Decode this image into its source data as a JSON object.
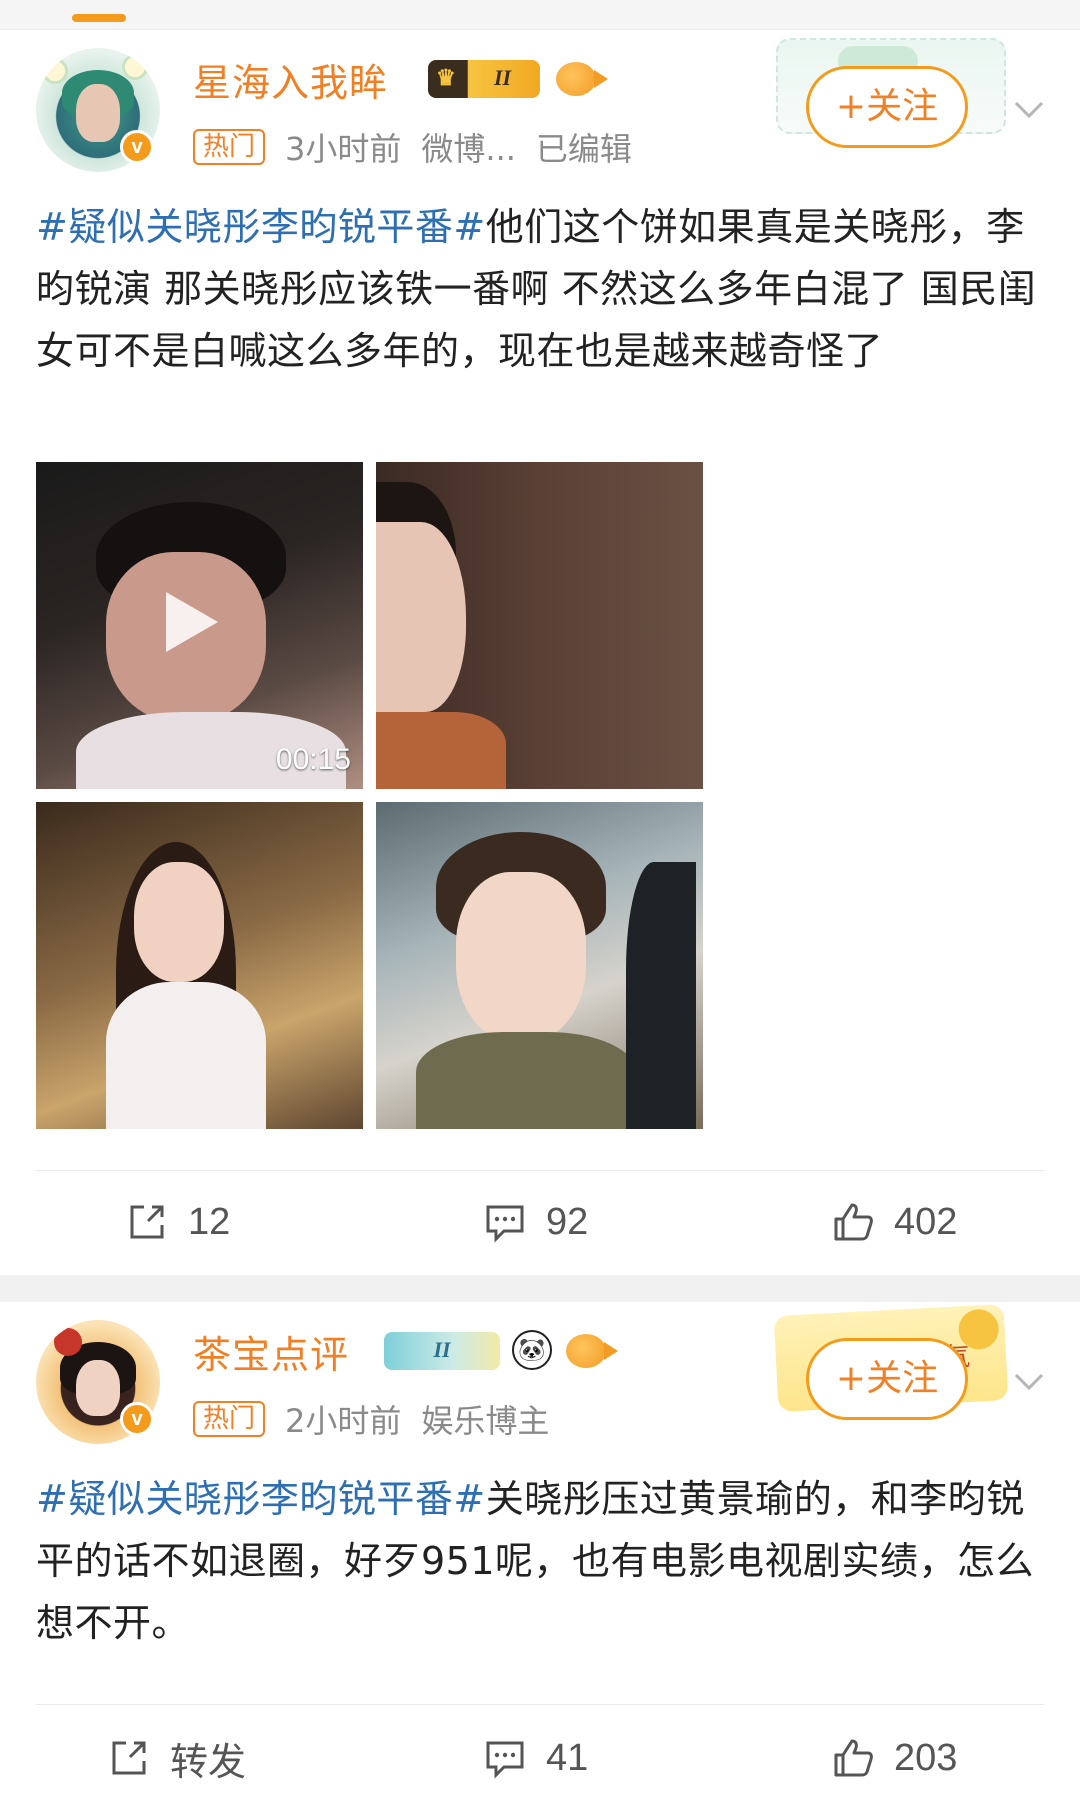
{
  "posts": [
    {
      "username": "星海入我眸",
      "badge_level": "II",
      "tag": "热门",
      "time": "3小时前",
      "source": "微博...",
      "edited": "已编辑",
      "follow_label": "+关注",
      "hashtag": "#疑似关晓彤李昀锐平番#",
      "text": "他们这个饼如果真是关晓彤，李昀锐演 那关晓彤应该铁一番啊 不然这么多年白混了 国民闺女可不是白喊这么多年的，现在也是越来越奇怪了",
      "media": {
        "video_duration": "00:15"
      },
      "actions": {
        "repost": "12",
        "comment": "92",
        "like": "402"
      }
    },
    {
      "username": "茶宝点评",
      "badge_level": "II",
      "tag": "热门",
      "time": "2小时前",
      "source": "娱乐博主",
      "follow_label": "+关注",
      "decoration_text": "点赞有福气",
      "hashtag": "#疑似关晓彤李昀锐平番#",
      "text": "关晓彤压过黄景瑜的，和李昀锐平的话不如退圈，好歹951呢，也有电影电视剧实绩，怎么想不开。",
      "actions": {
        "repost": "转发",
        "comment": "41",
        "like": "203"
      }
    }
  ],
  "colors": {
    "accent_orange": "#f17f24",
    "hashtag_blue": "#2e6fb3",
    "meta_gray": "#8a8a8a"
  },
  "icons": {
    "repost": "share-icon",
    "comment": "comment-icon",
    "like": "thumbs-up-icon",
    "more": "chevron-down-icon",
    "play": "play-icon"
  }
}
